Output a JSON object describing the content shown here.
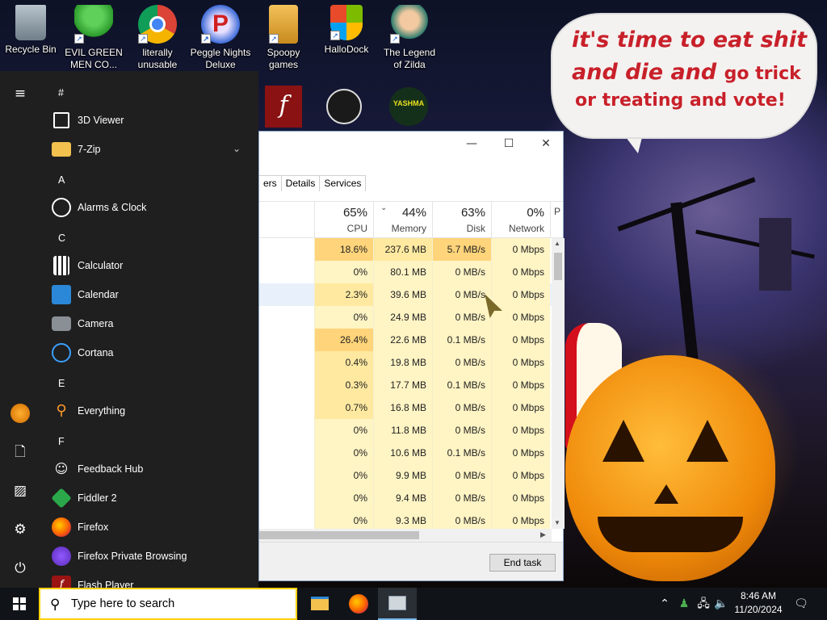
{
  "desktop": {
    "icons": [
      {
        "label": "Recycle Bin",
        "icon": "recycle-bin-icon"
      },
      {
        "label": "EVIL GREEN MEN CO...",
        "icon": "people-icon"
      },
      {
        "label": "literally unusable",
        "icon": "chrome-icon"
      },
      {
        "label": "Peggle Nights Deluxe",
        "icon": "peggle-icon"
      },
      {
        "label": "Spoopy games",
        "icon": "folder-icon"
      },
      {
        "label": "HalloDock",
        "icon": "windows-shield-icon"
      },
      {
        "label": "The Legend of Zilda",
        "icon": "game-character-icon"
      }
    ],
    "bubble": {
      "line1": "it's time to eat shit",
      "line2a": "and die and",
      "line2b": "go trick",
      "line3": "or treating and vote!"
    },
    "yashma_label": "YASHMA"
  },
  "task_manager": {
    "tabs": [
      "ers",
      "Details",
      "Services"
    ],
    "columns": [
      {
        "pct": "65%",
        "label": "CPU"
      },
      {
        "pct": "44%",
        "label": "Memory"
      },
      {
        "pct": "63%",
        "label": "Disk"
      },
      {
        "pct": "0%",
        "label": "Network"
      },
      {
        "pct": "",
        "label": "P"
      }
    ],
    "rows": [
      {
        "cpu": "18.6%",
        "mem": "237.6 MB",
        "disk": "5.7 MB/s",
        "net": "0 Mbps"
      },
      {
        "cpu": "0%",
        "mem": "80.1 MB",
        "disk": "0 MB/s",
        "net": "0 Mbps"
      },
      {
        "cpu": "2.3%",
        "mem": "39.6 MB",
        "disk": "0 MB/s",
        "net": "0 Mbps"
      },
      {
        "cpu": "0%",
        "mem": "24.9 MB",
        "disk": "0 MB/s",
        "net": "0 Mbps"
      },
      {
        "cpu": "26.4%",
        "mem": "22.6 MB",
        "disk": "0.1 MB/s",
        "net": "0 Mbps"
      },
      {
        "cpu": "0.4%",
        "mem": "19.8 MB",
        "disk": "0 MB/s",
        "net": "0 Mbps"
      },
      {
        "cpu": "0.3%",
        "mem": "17.7 MB",
        "disk": "0.1 MB/s",
        "net": "0 Mbps"
      },
      {
        "cpu": "0.7%",
        "mem": "16.8 MB",
        "disk": "0 MB/s",
        "net": "0 Mbps"
      },
      {
        "cpu": "0%",
        "mem": "11.8 MB",
        "disk": "0 MB/s",
        "net": "0 Mbps"
      },
      {
        "cpu": "0%",
        "mem": "10.6 MB",
        "disk": "0.1 MB/s",
        "net": "0 Mbps"
      },
      {
        "cpu": "0%",
        "mem": "9.9 MB",
        "disk": "0 MB/s",
        "net": "0 Mbps"
      },
      {
        "cpu": "0%",
        "mem": "9.4 MB",
        "disk": "0 MB/s",
        "net": "0 Mbps"
      },
      {
        "cpu": "0%",
        "mem": "9.3 MB",
        "disk": "0 MB/s",
        "net": "0 Mbps"
      }
    ],
    "end_task_label": "End task",
    "colors": {
      "heat_low": "#fff4c4",
      "heat_mid": "#ffe9a0",
      "heat_high": "#ffd47a",
      "selected_row": "#e8f1fb"
    }
  },
  "start_menu": {
    "sections": [
      {
        "letter": "#",
        "items": [
          {
            "label": "3D Viewer",
            "icon": "cube-icon"
          },
          {
            "label": "7-Zip",
            "icon": "folder-icon",
            "expand": "chevron-down-icon"
          }
        ]
      },
      {
        "letter": "A",
        "items": [
          {
            "label": "Alarms & Clock",
            "icon": "clock-icon"
          }
        ]
      },
      {
        "letter": "C",
        "items": [
          {
            "label": "Calculator",
            "icon": "calculator-icon"
          },
          {
            "label": "Calendar",
            "icon": "calendar-icon"
          },
          {
            "label": "Camera",
            "icon": "camera-icon"
          },
          {
            "label": "Cortana",
            "icon": "cortana-icon"
          }
        ]
      },
      {
        "letter": "E",
        "items": [
          {
            "label": "Everything",
            "icon": "magnifier-icon"
          }
        ]
      },
      {
        "letter": "F",
        "items": [
          {
            "label": "Feedback Hub",
            "icon": "feedback-icon"
          },
          {
            "label": "Fiddler 2",
            "icon": "fiddler-icon"
          },
          {
            "label": "Firefox",
            "icon": "firefox-icon"
          },
          {
            "label": "Firefox Private Browsing",
            "icon": "private-browsing-icon"
          },
          {
            "label": "Flash Player",
            "icon": "flash-icon"
          }
        ]
      }
    ],
    "rail": [
      "hamburger-icon",
      "user-avatar-icon",
      "documents-icon",
      "pictures-icon",
      "settings-icon",
      "power-icon"
    ]
  },
  "taskbar": {
    "search_placeholder": "Type here to search",
    "apps": [
      "file-explorer-icon",
      "firefox-icon",
      "task-manager-icon"
    ],
    "time": "8:46 AM",
    "date": "11/20/2024"
  }
}
